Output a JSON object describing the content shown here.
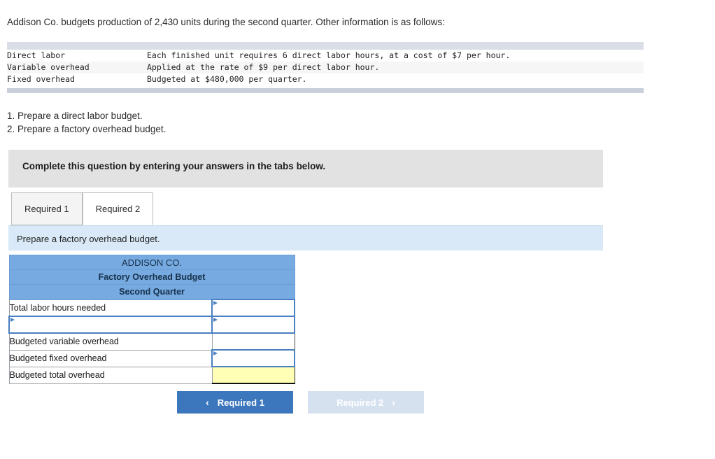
{
  "problem": {
    "intro": "Addison Co. budgets production of 2,430 units during the second quarter. Other information is as follows:",
    "facts": [
      {
        "label": "Direct labor",
        "desc": "Each finished unit requires 6 direct labor hours, at a cost of $7 per hour."
      },
      {
        "label": "Variable overhead",
        "desc": "Applied at the rate of $9 per direct labor hour."
      },
      {
        "label": "Fixed overhead",
        "desc": "Budgeted at $480,000 per quarter."
      }
    ],
    "requirements": [
      "1. Prepare a direct labor budget.",
      "2. Prepare a factory overhead budget."
    ]
  },
  "banner": {
    "text": "Complete this question by entering your answers in the tabs below."
  },
  "tabs": [
    {
      "label": "Required 1",
      "active": false
    },
    {
      "label": "Required 2",
      "active": true
    }
  ],
  "sub_instruction": {
    "text": "Prepare a factory overhead budget."
  },
  "budget_table": {
    "headers": [
      "ADDISON CO.",
      "Factory Overhead Budget",
      "Second Quarter"
    ],
    "rows": [
      {
        "label": "Total labor hours needed",
        "label_type": "text",
        "value": "",
        "value_type": "input"
      },
      {
        "label": "",
        "label_type": "input",
        "value": "",
        "value_type": "input"
      },
      {
        "label": "Budgeted variable overhead",
        "label_type": "text",
        "value": "",
        "value_type": "plain"
      },
      {
        "label": "Budgeted fixed overhead",
        "label_type": "text",
        "value": "",
        "value_type": "input"
      },
      {
        "label": "Budgeted total overhead",
        "label_type": "text",
        "value": "",
        "value_type": "total"
      }
    ]
  },
  "nav": {
    "prev": {
      "label": "Required 1",
      "icon": "chevron-left-icon",
      "glyph": "‹",
      "disabled": false
    },
    "next": {
      "label": "Required 2",
      "icon": "chevron-right-icon",
      "glyph": "›",
      "disabled": true
    }
  },
  "colors": {
    "header_blue": "#76aae0",
    "sub_instruction_blue": "#d9e9f7",
    "banner_gray": "#e2e2e2",
    "primary_button": "#3c77bd",
    "disabled_button": "#d6e1f0",
    "total_yellow": "#ffffb5",
    "input_border_blue": "#4a7fc1",
    "facts_bar": "#dadee6"
  }
}
